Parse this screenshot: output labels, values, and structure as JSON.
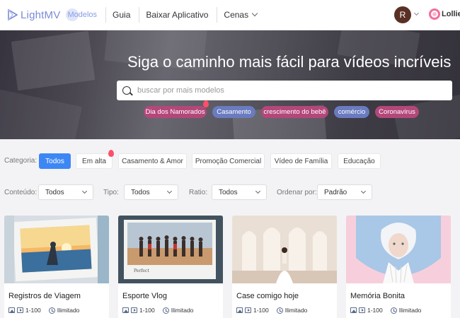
{
  "header": {
    "logo_text": "LightMV",
    "modelos": "Modelos",
    "nav": [
      "Guia",
      "Baixar Aplicativo",
      "Cenas"
    ],
    "avatar_initial": "R",
    "lollies": "Lollies"
  },
  "hero": {
    "title": "Siga o caminho mais fácil para vídeos incríveis",
    "search_placeholder": "buscar por mais modelos",
    "tags": [
      {
        "label": "Dia dos Namorados",
        "color": "#b4477a"
      },
      {
        "label": "Casamento",
        "color": "#6a7bc0"
      },
      {
        "label": "crescimento do bebê",
        "color": "#b4477a"
      },
      {
        "label": "comércio",
        "color": "#6a7bc0"
      },
      {
        "label": "Coronavírus",
        "color": "#b4477a"
      }
    ]
  },
  "category": {
    "label": "Categoria:",
    "items": [
      "Todos",
      "Em alta",
      "Casamento & Amor",
      "Promoção Comercial",
      "Vídeo de Família",
      "Educação"
    ],
    "active": "Todos"
  },
  "filters": [
    {
      "label": "Conteúdo:",
      "value": "Todos"
    },
    {
      "label": "Tipo:",
      "value": "Todos"
    },
    {
      "label": "Ratio:",
      "value": "Todos"
    },
    {
      "label": "Ordenar por:",
      "value": "Padrão"
    }
  ],
  "cards": [
    {
      "title": "Registros de Viagem",
      "range": "1-100",
      "duration": "Ilimitado"
    },
    {
      "title": "Esporte Vlog",
      "range": "1-100",
      "duration": "Ilimitado",
      "thumb_caption": "Perfect"
    },
    {
      "title": "Case comigo hoje",
      "range": "1-100",
      "duration": "Ilimitado"
    },
    {
      "title": "Memória Bonita",
      "range": "1-100",
      "duration": "Ilimitado"
    }
  ],
  "colors": {
    "accent": "#3d87f5",
    "logo": "#7b8bd6",
    "tag_pink": "#b4477a",
    "tag_blue": "#6a7bc0"
  }
}
